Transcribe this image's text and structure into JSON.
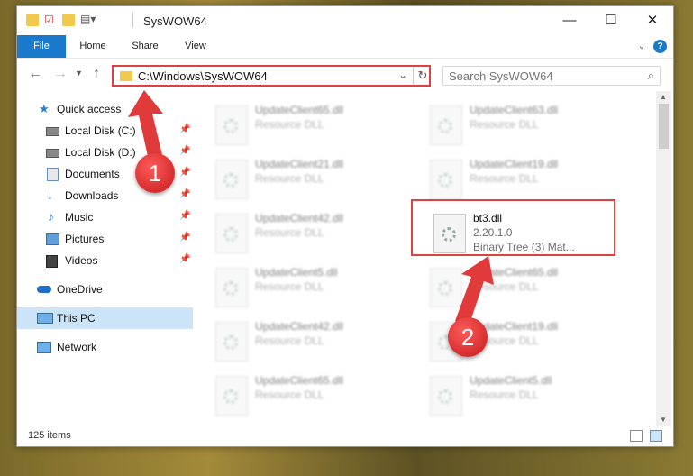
{
  "window": {
    "title": "SysWOW64",
    "controls": {
      "minimize": "—",
      "maximize": "☐",
      "close": "✕"
    }
  },
  "ribbon": {
    "tabs": [
      "File",
      "Home",
      "Share",
      "View"
    ],
    "expand": "⌄",
    "help": "?"
  },
  "address": {
    "path": "C:\\Windows\\SysWOW64",
    "search_placeholder": "Search SysWOW64"
  },
  "nav": {
    "items": [
      {
        "label": "Quick access",
        "icon": "star-icon",
        "pinned": false
      },
      {
        "label": "Local Disk (C:)",
        "icon": "drive-icon",
        "pinned": true
      },
      {
        "label": "Local Disk (D:)",
        "icon": "drive-icon",
        "pinned": true
      },
      {
        "label": "Documents",
        "icon": "documents-icon",
        "pinned": true
      },
      {
        "label": "Downloads",
        "icon": "download-icon",
        "pinned": true
      },
      {
        "label": "Music",
        "icon": "music-icon",
        "pinned": true
      },
      {
        "label": "Pictures",
        "icon": "pictures-icon",
        "pinned": true
      },
      {
        "label": "Videos",
        "icon": "videos-icon",
        "pinned": true
      },
      {
        "label": "OneDrive",
        "icon": "cloud-icon",
        "pinned": false
      },
      {
        "label": "This PC",
        "icon": "computer-icon",
        "pinned": false
      },
      {
        "label": "Network",
        "icon": "network-icon",
        "pinned": false
      }
    ]
  },
  "files": [
    {
      "name": "UpdateClient65.dll",
      "desc": "Resource DLL"
    },
    {
      "name": "UpdateClient63.dll",
      "desc": "Resource DLL"
    },
    {
      "name": "UpdateClient21.dll",
      "desc": "Resource DLL"
    },
    {
      "name": "UpdateClient19.dll",
      "desc": "Resource DLL"
    },
    {
      "name": "UpdateClient42.dll",
      "desc": "Resource DLL"
    },
    {
      "name": "bt3.dll",
      "desc": "2.20.1.0",
      "desc2": "Binary Tree (3) Mat..."
    },
    {
      "name": "UpdateClient5.dll",
      "desc": "Resource DLL"
    },
    {
      "name": "UpdateClient65.dll",
      "desc": "Resource DLL"
    },
    {
      "name": "UpdateClient42.dll",
      "desc": "Resource DLL"
    },
    {
      "name": "UpdateClient19.dll",
      "desc": "Resource DLL"
    },
    {
      "name": "UpdateClient65.dll",
      "desc": "Resource DLL"
    },
    {
      "name": "UpdateClient5.dll",
      "desc": "Resource DLL"
    }
  ],
  "status": {
    "count": "125 items"
  },
  "callouts": {
    "one": "1",
    "two": "2"
  },
  "colors": {
    "highlight": "#e04040",
    "file_tab": "#1979ca",
    "selected_nav": "#cce4f7"
  }
}
